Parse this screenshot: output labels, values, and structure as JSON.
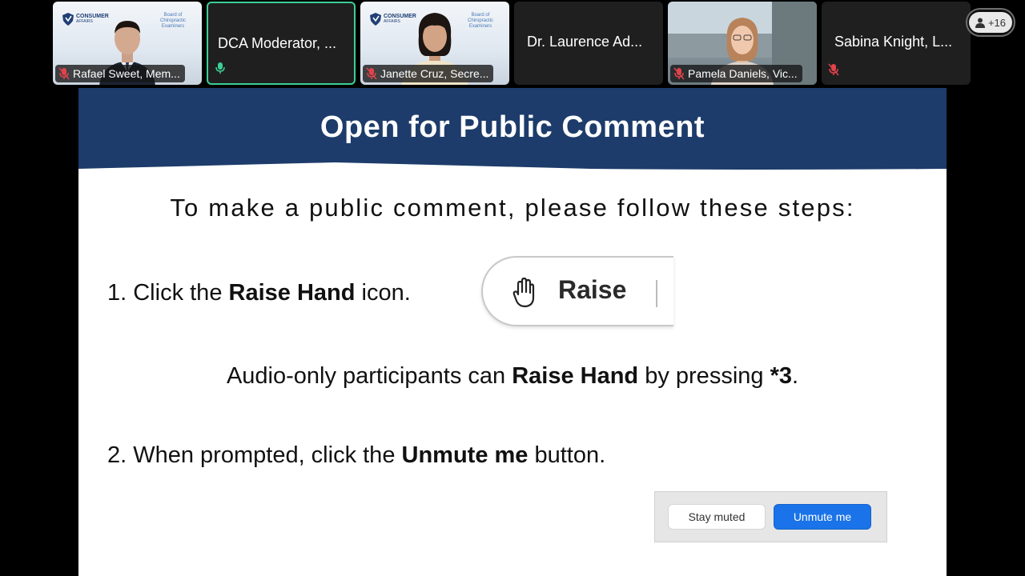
{
  "participants": [
    {
      "name": "Rafael Sweet, Mem...",
      "video": true,
      "muted": true,
      "backdrop": "consumer"
    },
    {
      "name": "DCA Moderator, ...",
      "video": false,
      "muted": false,
      "speaking": true
    },
    {
      "name": "Janette Cruz, Secre...",
      "video": true,
      "muted": true,
      "backdrop": "consumer"
    },
    {
      "name": "Dr. Laurence Ad...",
      "video": false,
      "muted": false
    },
    {
      "name": "Pamela Daniels, Vic...",
      "video": true,
      "muted": true,
      "backdrop": "office"
    },
    {
      "name": "Sabina Knight, L...",
      "video": false,
      "muted": true
    }
  ],
  "backdrop_text": {
    "consumer_logo": "CONSUMER",
    "consumer_logo_sub": "AFFAIRS",
    "board_logo": "Board of Chiropractic Examiners"
  },
  "overflow_count": "+16",
  "slide": {
    "title": "Open for Public Comment",
    "intro": "To make a public comment, please follow these steps:",
    "step1_prefix": "1. Click the ",
    "step1_bold": "Raise Hand",
    "step1_suffix": " icon.",
    "raise_button_label": "Raise",
    "audio_prefix": "Audio-only participants can ",
    "audio_bold": "Raise Hand",
    "audio_mid": " by pressing ",
    "audio_code": "*3",
    "audio_suffix": ".",
    "step2_prefix": "2.  When prompted, click the ",
    "step2_bold": "Unmute me",
    "step2_suffix": " button.",
    "stay_muted_label": "Stay muted",
    "unmute_label": "Unmute me"
  },
  "colors": {
    "header_bg": "#1d3c6b",
    "speaking_border": "#3ccf95",
    "muted_mic": "#e0434b",
    "unmute_button": "#1a73e8"
  }
}
